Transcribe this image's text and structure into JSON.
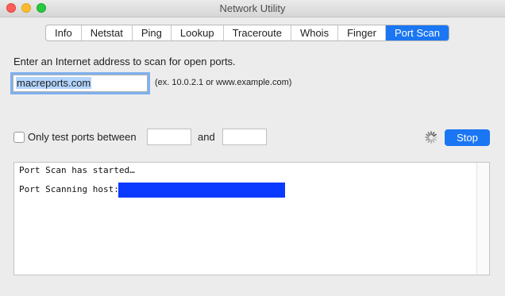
{
  "window": {
    "title": "Network Utility"
  },
  "tabs": [
    {
      "label": "Info",
      "active": false
    },
    {
      "label": "Netstat",
      "active": false
    },
    {
      "label": "Ping",
      "active": false
    },
    {
      "label": "Lookup",
      "active": false
    },
    {
      "label": "Traceroute",
      "active": false
    },
    {
      "label": "Whois",
      "active": false
    },
    {
      "label": "Finger",
      "active": false
    },
    {
      "label": "Port Scan",
      "active": true
    }
  ],
  "portscan": {
    "instruction": "Enter an Internet address to scan for open ports.",
    "address_value": "macreports.com",
    "address_hint": "(ex. 10.0.2.1 or www.example.com)",
    "range_checkbox_label": "Only test ports between",
    "range_checkbox_checked": false,
    "range_from": "",
    "range_to": "",
    "and_label": "and",
    "stop_label": "Stop",
    "busy": true
  },
  "output": {
    "lines": [
      "Port Scan has started…",
      "Port Scanning host:"
    ]
  },
  "colors": {
    "accent": "#1a76f2",
    "redaction": "#0a3aff"
  }
}
